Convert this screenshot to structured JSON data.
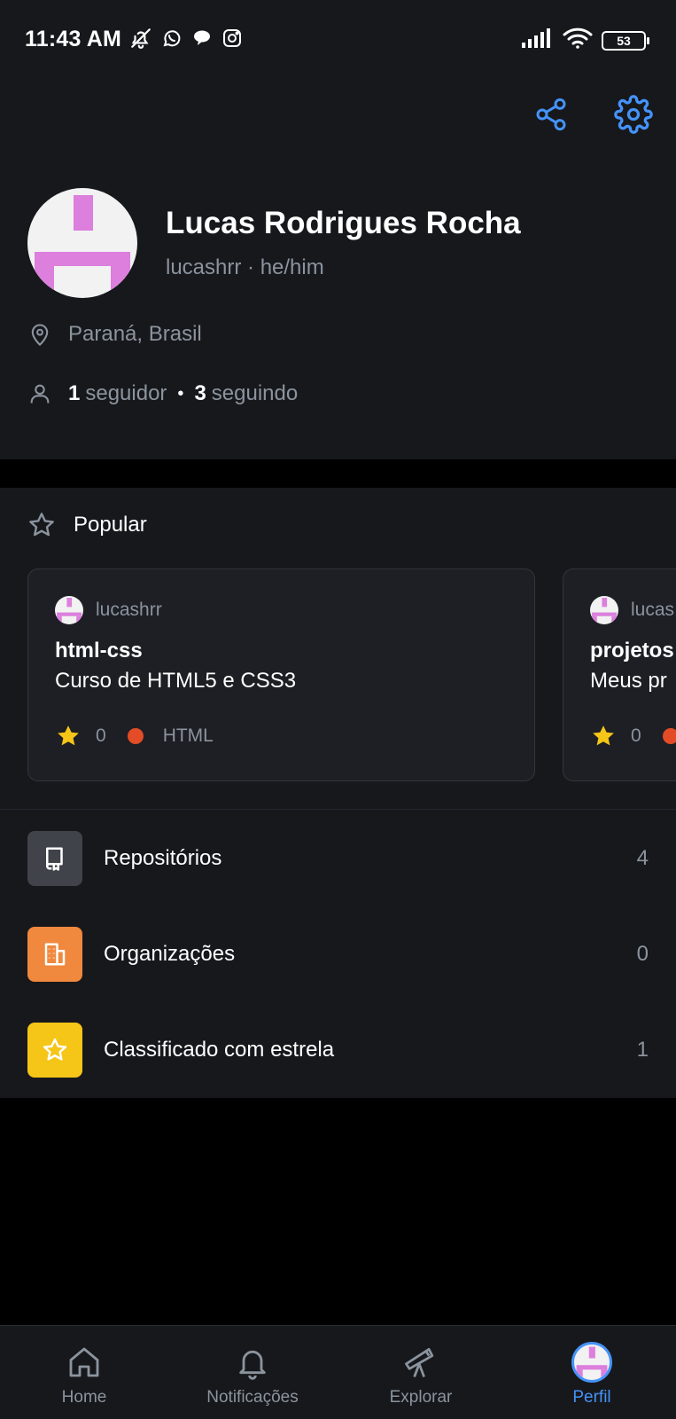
{
  "status_bar": {
    "time": "11:43 AM",
    "battery": "53",
    "left_icons": [
      "bell-off-icon",
      "whatsapp-icon",
      "chat-bubble-icon",
      "instagram-icon"
    ],
    "right_icons": [
      "signal-icon",
      "wifi-icon",
      "battery-icon"
    ]
  },
  "profile": {
    "name": "Lucas Rodrigues Rocha",
    "handle_line": "lucashrr · he/him",
    "location": "Paraná, Brasil",
    "followers_count": "1",
    "followers_label": "seguidor",
    "following_count": "3",
    "following_label": "seguindo",
    "actions": [
      "share-icon",
      "settings-icon"
    ]
  },
  "popular": {
    "title": "Popular",
    "cards": [
      {
        "owner": "lucashrr",
        "repo": "html-css",
        "description": "Curso de HTML5 e CSS3",
        "stars": "0",
        "language": "HTML",
        "language_color": "#e34c26"
      },
      {
        "owner": "lucas",
        "repo": "projetos",
        "description": "Meus pr",
        "stars": "0",
        "language": "",
        "language_color": "#e34c26"
      }
    ]
  },
  "lists": [
    {
      "label": "Repositórios",
      "count": "4",
      "icon": "repo-icon",
      "color": "#41434b"
    },
    {
      "label": "Organizações",
      "count": "0",
      "icon": "organization-icon",
      "color": "#f0883e"
    },
    {
      "label": "Classificado com estrela",
      "count": "1",
      "icon": "star-icon",
      "color": "#f5c518"
    }
  ],
  "tabs": [
    {
      "label": "Home",
      "icon": "home-icon"
    },
    {
      "label": "Notificações",
      "icon": "bell-icon"
    },
    {
      "label": "Explorar",
      "icon": "telescope-icon"
    },
    {
      "label": "Perfil",
      "icon": "avatar",
      "active": true
    }
  ],
  "colors": {
    "accent": "#4493f8",
    "background": "#17181c",
    "star": "#f5c518",
    "html": "#e34c26"
  }
}
